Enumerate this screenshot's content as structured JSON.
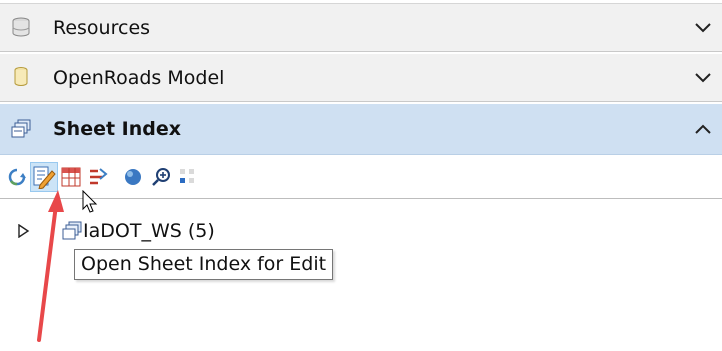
{
  "panels": {
    "resources": {
      "label": "Resources",
      "icon": "database-icon",
      "state": "collapsed"
    },
    "openroads_model": {
      "label": "OpenRoads Model",
      "icon": "cylinder-model-icon",
      "state": "collapsed"
    },
    "sheet_index": {
      "label": "Sheet Index",
      "icon": "sheet-index-icon",
      "state": "expanded"
    }
  },
  "toolbar": {
    "buttons": [
      {
        "icon": "refresh-icon"
      },
      {
        "icon": "edit-sheet-index-icon",
        "active": true
      },
      {
        "icon": "table-select-icon"
      },
      {
        "icon": "sheet-tree-icon"
      },
      {
        "icon": "sphere-icon"
      },
      {
        "icon": "zoom-icon"
      },
      {
        "icon": "grid-dots-icon"
      }
    ]
  },
  "tree": {
    "root": {
      "label": "IaDOT_WS (5)",
      "expanded": false
    }
  },
  "tooltip": {
    "text": "Open Sheet Index for Edit"
  },
  "colors": {
    "header_bg": "#f1f1f1",
    "active_header_bg": "#cfe0f2",
    "annotation_arrow": "#e8484a"
  }
}
